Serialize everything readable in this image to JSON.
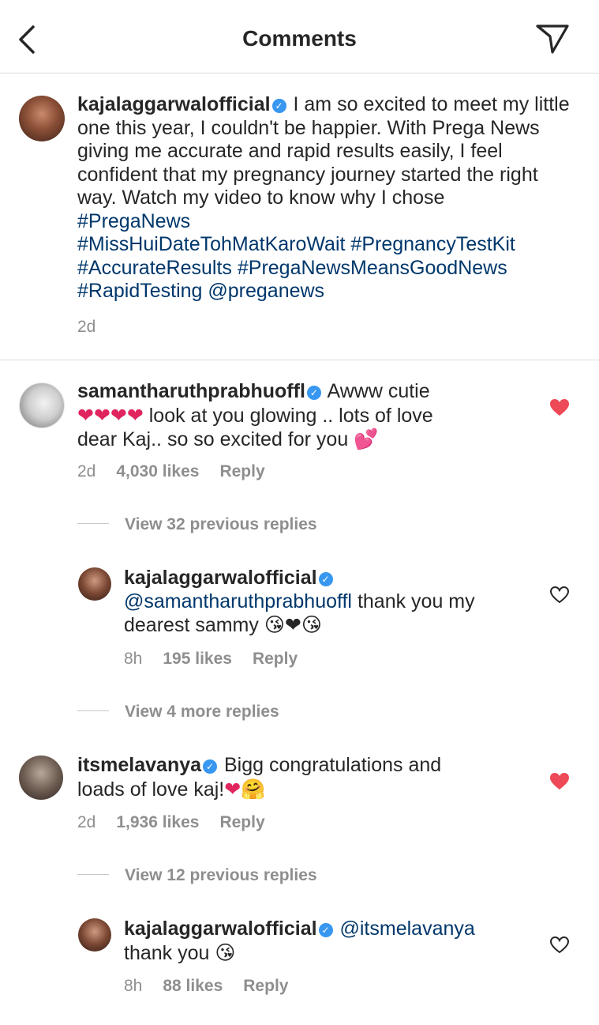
{
  "header": {
    "title": "Comments"
  },
  "caption": {
    "username": "kajalaggarwalofficial",
    "text": "I am so excited to meet my little one this year, I couldn't be happier. With Prega News giving me accurate and rapid results easily, I feel confident that my pregnancy journey started the right way. Watch my video to know why I chose",
    "hashtags_line1": "#PregaNews",
    "hashtags_line2": "#MissHuiDateTohMatKaroWait #PregnancyTestKit",
    "hashtags_line3": "#AccurateResults #PregaNewsMeansGoodNews",
    "hashtags_line4": "#RapidTesting @preganews",
    "time": "2d"
  },
  "comment1": {
    "username": "samantharuthprabhuoffl",
    "text_start": "Awww cutie",
    "hearts": "❤❤❤❤",
    "text_mid": "look at you glowing .. lots of love",
    "text_end": "dear Kaj.. so so excited for you",
    "emoji_end": "💕",
    "time": "2d",
    "likes": "4,030 likes",
    "reply": "Reply",
    "liked": true,
    "view_replies": "View 32 previous replies"
  },
  "reply1": {
    "username": "kajalaggarwalofficial",
    "mention": "@samantharuthprabhuoffl",
    "text_a": "thank you my",
    "text_b": "dearest sammy",
    "emojis": "😘❤😘",
    "time": "8h",
    "likes": "195 likes",
    "reply": "Reply",
    "liked": false,
    "view_more": "View 4 more replies"
  },
  "comment2": {
    "username": "itsmelavanya",
    "text_a": "Bigg congratulations and",
    "text_b": "loads of love kaj!",
    "emojis": "❤🤗",
    "time": "2d",
    "likes": "1,936 likes",
    "reply": "Reply",
    "liked": true,
    "view_replies": "View 12 previous replies"
  },
  "reply2": {
    "username": "kajalaggarwalofficial",
    "mention": "@itsmelavanya",
    "text": "thank you",
    "emoji": "😘",
    "time": "8h",
    "likes": "88 likes",
    "reply": "Reply",
    "liked": false
  },
  "colors": {
    "link": "#00376b",
    "verified": "#3897f0",
    "like": "#ed4956",
    "meta": "#8e8e8e"
  }
}
